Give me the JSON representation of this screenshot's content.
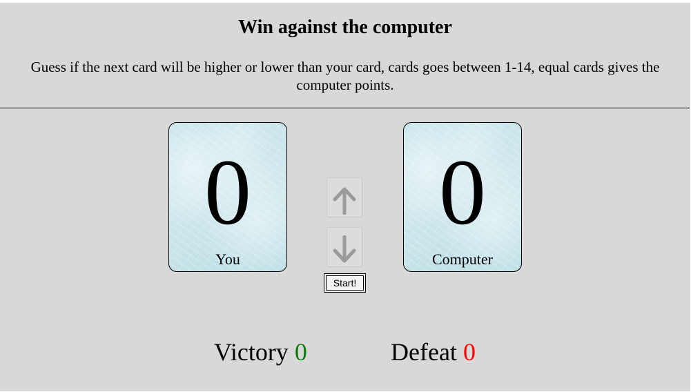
{
  "header": {
    "title": "Win against the computer",
    "instructions": "Guess if the next card will be higher or lower than your card, cards goes between 1-14, equal cards gives the computer points."
  },
  "cards": {
    "you": {
      "value": "0",
      "label": "You"
    },
    "computer": {
      "value": "0",
      "label": "Computer"
    }
  },
  "controls": {
    "higher_icon": "arrow-up-icon",
    "lower_icon": "arrow-down-icon",
    "start_label": "Start!"
  },
  "score": {
    "victory_label": "Victory",
    "victory_count": "0",
    "defeat_label": "Defeat",
    "defeat_count": "0"
  },
  "colors": {
    "background": "#d8d8d8",
    "card_tint": "#c4e3ea",
    "arrow_gray": "#9a9a9a",
    "victory": "#0a7a0a",
    "defeat": "#ff0000"
  }
}
